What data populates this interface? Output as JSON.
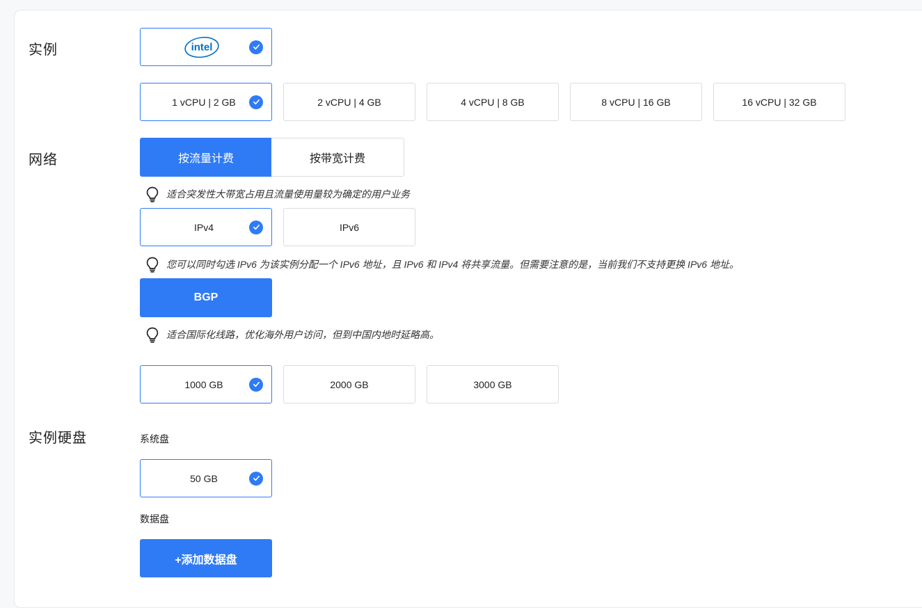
{
  "sections": {
    "instance": "实例",
    "network": "网络",
    "disk": "实例硬盘"
  },
  "instance": {
    "cpu_brand": "intel",
    "plans": [
      "1 vCPU | 2 GB",
      "2 vCPU | 4 GB",
      "4 vCPU | 8 GB",
      "8 vCPU | 16 GB",
      "16 vCPU | 32 GB"
    ],
    "selected_plan": "1 vCPU | 2 GB"
  },
  "network": {
    "billing_options": [
      "按流量计费",
      "按带宽计费"
    ],
    "selected_billing": "按流量计费",
    "billing_hint": "适合突发性大带宽占用且流量使用量较为确定的用户业务",
    "ip_options": [
      "IPv4",
      "IPv6"
    ],
    "selected_ip": "IPv4",
    "ip_hint": "您可以同时勾选 IPv6 为该实例分配一个 IPv6 地址，且 IPv6 和 IPv4 将共享流量。但需要注意的是，当前我们不支持更换 IPv6 地址。",
    "line": "BGP",
    "line_hint": "适合国际化线路，优化海外用户访问，但到中国内地时延略高。",
    "traffic_options": [
      "1000 GB",
      "2000 GB",
      "3000 GB"
    ],
    "selected_traffic": "1000 GB"
  },
  "disk": {
    "system_label": "系统盘",
    "system_size": "50 GB",
    "data_label": "数据盘",
    "add_data_disk": "+添加数据盘"
  },
  "colors": {
    "accent": "#2f7bf5",
    "intel_blue": "#0071c5"
  }
}
